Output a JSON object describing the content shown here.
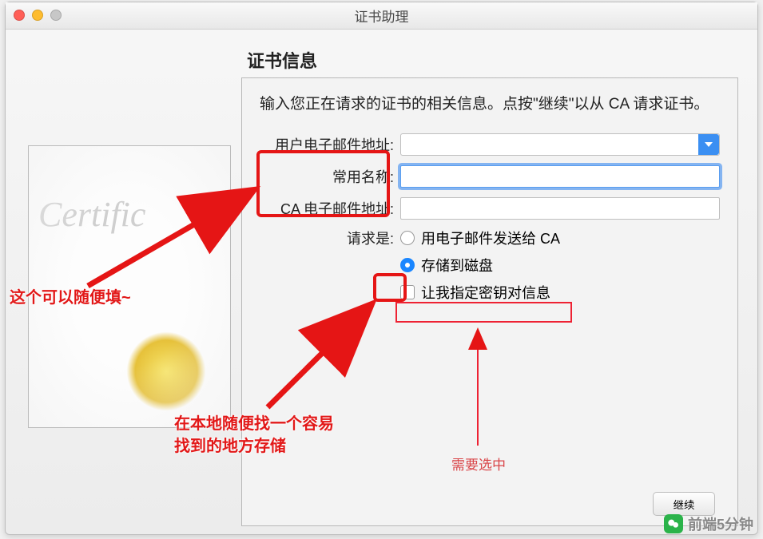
{
  "window": {
    "title": "证书助理"
  },
  "section": {
    "title": "证书信息"
  },
  "instruction": "输入您正在请求的证书的相关信息。点按\"继续\"以从 CA 请求证书。",
  "labels": {
    "email": "用户电子邮件地址:",
    "common_name": "常用名称:",
    "ca_email": "CA 电子邮件地址:",
    "request_is": "请求是:"
  },
  "fields": {
    "email_value": "",
    "common_name_value": "",
    "ca_email_value": ""
  },
  "radios": {
    "send_to_ca": "用电子邮件发送给 CA",
    "save_to_disk": "存储到磁盘"
  },
  "checkbox": {
    "specify_key_pair": "让我指定密钥对信息"
  },
  "buttons": {
    "continue": "继续"
  },
  "certificate_placeholder": {
    "script": "Certific"
  },
  "annotations": {
    "left_hint": "这个可以随便填~",
    "bottom_hint_line1": "在本地随便找一个容易",
    "bottom_hint_line2": "找到的地方存储",
    "need_select": "需要选中"
  },
  "watermark": {
    "text": "前端5分钟"
  }
}
